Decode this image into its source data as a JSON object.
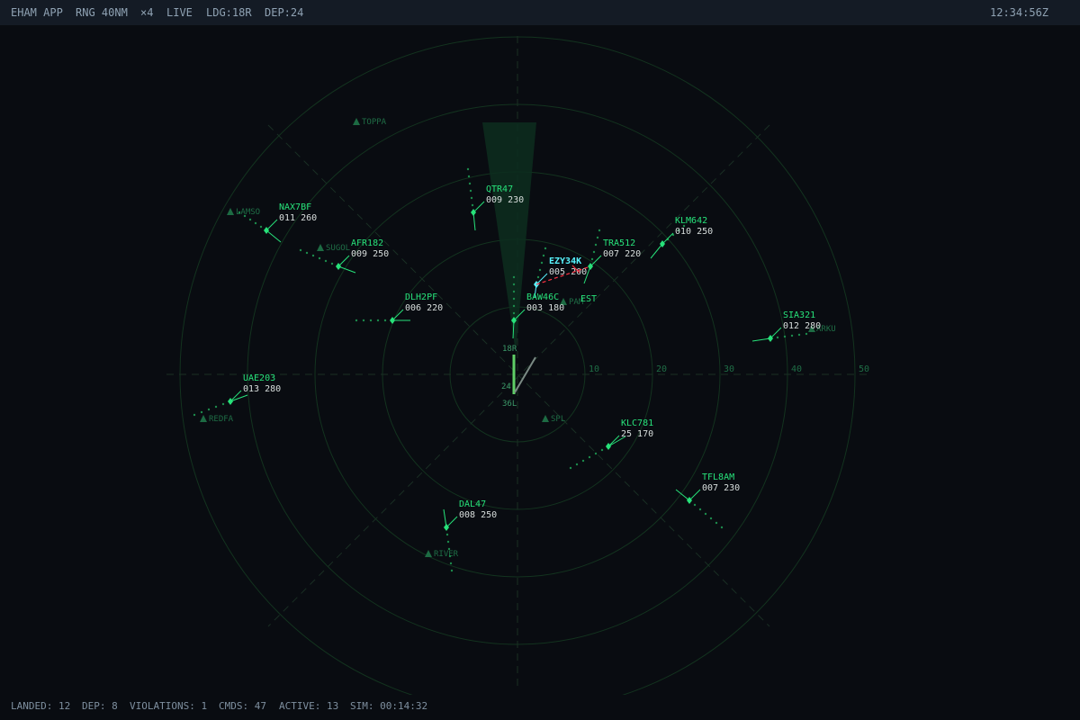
{
  "header": {
    "facility": "EHAM APP",
    "range": "RNG 40NM",
    "speed": "×4",
    "mode": "LIVE",
    "landing": "LDG:18R",
    "departure": "DEP:24",
    "clock": "12:34:56Z"
  },
  "scope": {
    "ring_labels": [
      "10",
      "20",
      "30",
      "40",
      "50"
    ],
    "runways": {
      "rwy_18r": "18R",
      "rwy_36l": "36L",
      "rwy_24": "24"
    },
    "fixes": [
      {
        "name": "TOPPA"
      },
      {
        "name": "LAMSO"
      },
      {
        "name": "SUGOL"
      },
      {
        "name": "PAM"
      },
      {
        "name": "ARKU"
      },
      {
        "name": "SPL"
      },
      {
        "name": "REDFA"
      },
      {
        "name": "RIVER"
      }
    ],
    "aircraft": [
      {
        "callsign": "QTR47",
        "data": "009 230"
      },
      {
        "callsign": "NAX7BF",
        "data": "011 260"
      },
      {
        "callsign": "AFR182",
        "data": "009 250"
      },
      {
        "callsign": "KLM642",
        "data": "010 250"
      },
      {
        "callsign": "TRA512",
        "data": "007 220"
      },
      {
        "callsign": "EZY34K",
        "data": "005 200",
        "selected": true,
        "est_label": "EST"
      },
      {
        "callsign": "BAW46C",
        "data": "003 180"
      },
      {
        "callsign": "DLH2PF",
        "data": "006 220"
      },
      {
        "callsign": "SIA321",
        "data": "012 280"
      },
      {
        "callsign": "UAE203",
        "data": "013 280"
      },
      {
        "callsign": "KLC781",
        "data": "25 170"
      },
      {
        "callsign": "TFL8AM",
        "data": "007 230"
      },
      {
        "callsign": "DAL47",
        "data": "008 250"
      }
    ],
    "colors": {
      "target": "#27e27a",
      "selected": "#58f5ff",
      "conflict": "#ff3344",
      "ring": "#13331f"
    }
  },
  "footer": {
    "landed": "LANDED: 12",
    "dep": "DEP: 8",
    "violations": "VIOLATIONS: 1",
    "cmds": "CMDS: 47",
    "active": "ACTIVE: 13",
    "sim": "SIM: 00:14:32"
  }
}
